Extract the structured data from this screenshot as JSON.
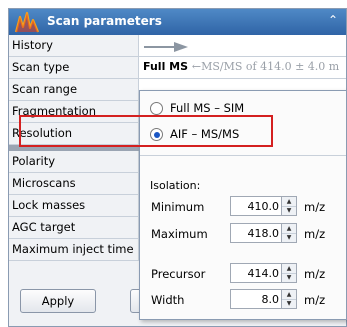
{
  "title": "Scan parameters",
  "collapse_glyph": "⌃",
  "rows": {
    "history": "History",
    "scan_type": "Scan type",
    "scan_range": "Scan range",
    "fragmentation": "Fragmentation",
    "resolution": "Resolution",
    "polarity": "Polarity",
    "microscans": "Microscans",
    "lock_masses": "Lock masses",
    "agc_target": "AGC target",
    "max_inject_time": "Maximum inject time"
  },
  "scan_type_value": {
    "current": "Full MS",
    "arrow": "←",
    "alt": "MS/MS of 414.0 ± 4.0 m"
  },
  "popup": {
    "options": [
      "Full MS – SIM",
      "AIF – MS/MS"
    ],
    "selected_index": 1,
    "isolation_label": "Isolation:",
    "fields": {
      "minimum": {
        "label": "Minimum",
        "value": "410.0",
        "unit": "m/z"
      },
      "maximum": {
        "label": "Maximum",
        "value": "418.0",
        "unit": "m/z"
      },
      "precursor": {
        "label": "Precursor",
        "value": "414.0",
        "unit": "m/z"
      },
      "width": {
        "label": "Width",
        "value": "8.0",
        "unit": "m/z"
      }
    },
    "spin_up": "▲",
    "spin_down": "▼"
  },
  "apply_label": "Apply",
  "colors": {
    "accent": "#2f64a6",
    "highlight": "#d42020",
    "radio": "#1a56c4"
  }
}
